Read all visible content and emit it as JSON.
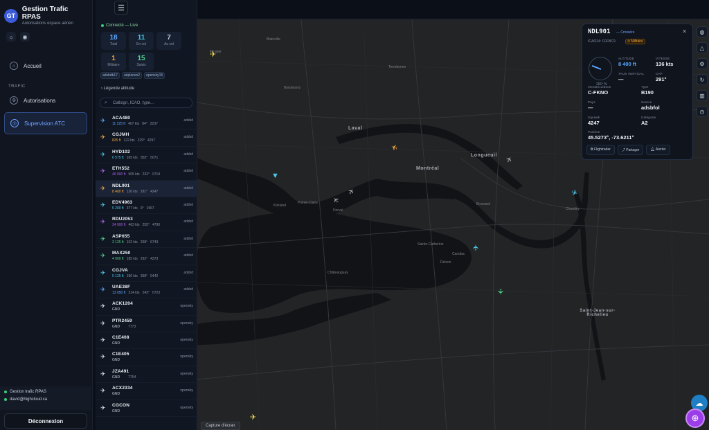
{
  "brand": {
    "logo": "GT",
    "title": "Gestion Trafic RPAS",
    "subtitle": "Autorisations espace aérien",
    "icons": [
      "sun-icon",
      "eye-icon"
    ]
  },
  "nav": {
    "items": [
      {
        "label": "Accueil",
        "icon": "home-icon"
      },
      {
        "label": "Autorisations",
        "icon": "drone-icon"
      },
      {
        "label": "Supervision ATC",
        "icon": "radar-icon"
      }
    ],
    "section_label": "TRAFIC"
  },
  "footer": {
    "app": "Gestion trafic RPAS",
    "user": "david@highcloud.ca",
    "logout": "Déconnexion"
  },
  "traffic": {
    "status": "Connecté — Live",
    "stats": [
      {
        "value": "18",
        "label": "Total"
      },
      {
        "value": "11",
        "label": "En vol"
      },
      {
        "value": "7",
        "label": "Au sol"
      },
      {
        "value": "1",
        "label": "Militaire"
      },
      {
        "value": "15",
        "label": "Suivis"
      }
    ],
    "sources": [
      "adsbdb17",
      "airplanes2",
      "opensky15"
    ],
    "legend": "Légende altitude",
    "search_placeholder": "Callsign, ICAO, type..."
  },
  "flights": [
    {
      "callsign": "ACA480",
      "alt": "11 225 ft",
      "spd": "407 kts",
      "hdg": "84°",
      "vs": "2237",
      "src": "adsbd",
      "color": "#5aa8ff"
    },
    {
      "callsign": "CGJMH",
      "alt": "825 ft",
      "spd": "122 kts",
      "hdg": "229°",
      "vs": "4297",
      "src": "adsbd",
      "color": "#f0a540"
    },
    {
      "callsign": "HYD102",
      "alt": "6 575 ft",
      "spd": "165 kts",
      "hdg": "303°",
      "vs": "5071",
      "src": "adsbd",
      "color": "#49c7e8"
    },
    {
      "callsign": "ETH552",
      "alt": "40 000 ft",
      "spd": "505 kts",
      "hdg": "232°",
      "vs": "0719",
      "src": "adsbd",
      "color": "#b05ef0"
    },
    {
      "callsign": "NDL901",
      "alt": "8 400 ft",
      "spd": "136 kts",
      "hdg": "291°",
      "vs": "4247",
      "src": "adsbd",
      "color": "#f0a540"
    },
    {
      "callsign": "EDV4963",
      "alt": "5 200 ft",
      "spd": "377 kts",
      "hdg": "9°",
      "vs": "1567",
      "src": "adsbd",
      "color": "#49c7e8"
    },
    {
      "callsign": "RDU2053",
      "alt": "34 000 ft",
      "spd": "463 kts",
      "hdg": "255°",
      "vs": "4790",
      "src": "adsbd",
      "color": "#b05ef0"
    },
    {
      "callsign": "ASP655",
      "alt": "3 125 ft",
      "spd": "162 kts",
      "hdg": "258°",
      "vs": "6743",
      "src": "adsbd",
      "color": "#52d08a"
    },
    {
      "callsign": "MAX250",
      "alt": "4 000 ft",
      "spd": "185 kts",
      "hdg": "292°",
      "vs": "4373",
      "src": "adsbd",
      "color": "#52d08a"
    },
    {
      "callsign": "CGJVA",
      "alt": "5 125 ft",
      "spd": "190 kts",
      "hdg": "358°",
      "vs": "5442",
      "src": "adsbd",
      "color": "#49c7e8"
    },
    {
      "callsign": "UAE38F",
      "alt": "13 050 ft",
      "spd": "314 kts",
      "hdg": "243°",
      "vs": "0723",
      "src": "adsbd",
      "color": "#5aa8ff"
    },
    {
      "callsign": "ACK1204",
      "alt": "GND",
      "spd": "",
      "hdg": "",
      "vs": "",
      "src": "opensky",
      "color": "#d7dde8"
    },
    {
      "callsign": "PTR2459",
      "alt": "GND",
      "spd": "",
      "hdg": "",
      "vs": "7773",
      "src": "opensky",
      "color": "#d7dde8"
    },
    {
      "callsign": "C1E408",
      "alt": "GND",
      "spd": "",
      "hdg": "",
      "vs": "",
      "src": "opensky",
      "color": "#d7dde8"
    },
    {
      "callsign": "C1E405",
      "alt": "GND",
      "spd": "",
      "hdg": "",
      "vs": "",
      "src": "opensky",
      "color": "#d7dde8"
    },
    {
      "callsign": "JZA491",
      "alt": "GND",
      "spd": "",
      "hdg": "",
      "vs": "7754",
      "src": "opensky",
      "color": "#d7dde8"
    },
    {
      "callsign": "ACX2334",
      "alt": "GND",
      "spd": "",
      "hdg": "",
      "vs": "",
      "src": "opensky",
      "color": "#d7dde8"
    },
    {
      "callsign": "CGCON",
      "alt": "GND",
      "spd": "",
      "hdg": "",
      "vs": "",
      "src": "opensky",
      "color": "#d7dde8"
    }
  ],
  "map": {
    "labels": [
      "Mirabel",
      "Laval",
      "Montréal",
      "Longueuil",
      "Dorval",
      "Pointe-Claire",
      "Kirkland",
      "Châteauguay",
      "Brossard",
      "Saint-Jean-sur-Richelieu",
      "Chambly",
      "Blainville",
      "Terrebonne",
      "Boisbriand",
      "Candiac",
      "Delson",
      "Sainte-Catherine"
    ],
    "capture_button": "Capture d'écran"
  },
  "detail": {
    "callsign": "NDL901",
    "phase": "— Croisière",
    "icao": "ICAO24: C0FBC9",
    "tag": "Militaire",
    "heading_label": "291° N",
    "altitude_label": "ALTITUDE",
    "altitude": "8 400 ft",
    "speed_label": "VITESSE",
    "speed": "136 kts",
    "vrate_label": "TAUX VERTICAL",
    "vrate": "—",
    "cap_label": "CAP",
    "cap": "291°",
    "reg_label": "Immatriculation",
    "reg": "C-FKNO",
    "type_label": "Type",
    "type": "B190",
    "country_label": "Pays",
    "country": "—",
    "source_label": "Source",
    "source": "adsbfol",
    "squawk_label": "Squawk",
    "squawk": "4247",
    "cat_label": "Catégorie",
    "cat": "A2",
    "pos_label": "Position",
    "pos": "45.5273°, -73.6211°",
    "buttons": [
      "Flightradar",
      "Partager",
      "Alerter"
    ]
  }
}
